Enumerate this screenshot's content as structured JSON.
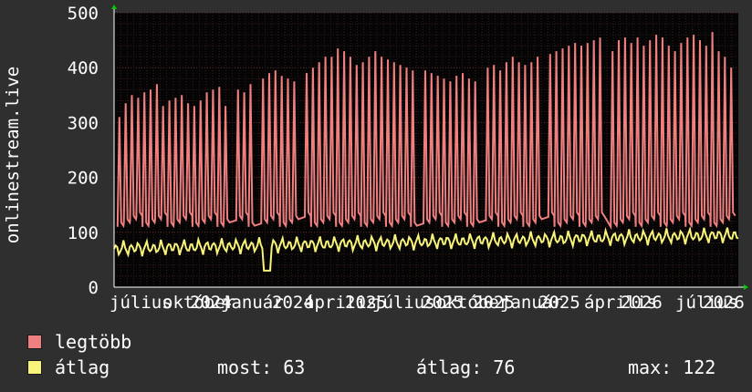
{
  "chart_data": {
    "type": "line",
    "ylabel": "onlinestream.live",
    "ylim": [
      0,
      500
    ],
    "yticks": [
      0,
      100,
      200,
      300,
      400,
      500
    ],
    "grid": true,
    "xticks": [
      "július",
      "október",
      "2024",
      "január",
      "2024",
      "április",
      "2025",
      "július",
      "2025",
      "október",
      "2025",
      "január",
      "2025",
      "április",
      "2026",
      "július",
      "2026"
    ],
    "series": [
      {
        "name": "legtöbb",
        "color": "#f07f7f",
        "peaks": [
          [
            0.01,
            310
          ],
          [
            0.02,
            335
          ],
          [
            0.03,
            350
          ],
          [
            0.04,
            345
          ],
          [
            0.05,
            355
          ],
          [
            0.06,
            360
          ],
          [
            0.07,
            370
          ],
          [
            0.08,
            330
          ],
          [
            0.09,
            340
          ],
          [
            0.1,
            345
          ],
          [
            0.11,
            350
          ],
          [
            0.12,
            335
          ],
          [
            0.13,
            330
          ],
          [
            0.14,
            340
          ],
          [
            0.15,
            355
          ],
          [
            0.16,
            360
          ],
          [
            0.17,
            365
          ],
          [
            0.18,
            330
          ],
          [
            0.2,
            360
          ],
          [
            0.21,
            355
          ],
          [
            0.22,
            370
          ],
          [
            0.24,
            380
          ],
          [
            0.25,
            390
          ],
          [
            0.26,
            395
          ],
          [
            0.27,
            385
          ],
          [
            0.28,
            380
          ],
          [
            0.29,
            375
          ],
          [
            0.31,
            390
          ],
          [
            0.32,
            400
          ],
          [
            0.33,
            410
          ],
          [
            0.34,
            420
          ],
          [
            0.35,
            420
          ],
          [
            0.36,
            435
          ],
          [
            0.37,
            430
          ],
          [
            0.38,
            420
          ],
          [
            0.39,
            405
          ],
          [
            0.4,
            410
          ],
          [
            0.41,
            420
          ],
          [
            0.42,
            430
          ],
          [
            0.43,
            420
          ],
          [
            0.44,
            415
          ],
          [
            0.45,
            410
          ],
          [
            0.46,
            405
          ],
          [
            0.47,
            400
          ],
          [
            0.48,
            395
          ],
          [
            0.5,
            395
          ],
          [
            0.51,
            390
          ],
          [
            0.52,
            385
          ],
          [
            0.53,
            380
          ],
          [
            0.54,
            375
          ],
          [
            0.55,
            385
          ],
          [
            0.56,
            390
          ],
          [
            0.57,
            380
          ],
          [
            0.58,
            375
          ],
          [
            0.6,
            400
          ],
          [
            0.61,
            405
          ],
          [
            0.62,
            395
          ],
          [
            0.63,
            410
          ],
          [
            0.64,
            420
          ],
          [
            0.65,
            410
          ],
          [
            0.66,
            405
          ],
          [
            0.67,
            410
          ],
          [
            0.68,
            420
          ],
          [
            0.7,
            425
          ],
          [
            0.71,
            430
          ],
          [
            0.72,
            435
          ],
          [
            0.73,
            440
          ],
          [
            0.74,
            445
          ],
          [
            0.75,
            440
          ],
          [
            0.76,
            445
          ],
          [
            0.77,
            450
          ],
          [
            0.78,
            455
          ],
          [
            0.8,
            430
          ],
          [
            0.81,
            450
          ],
          [
            0.82,
            455
          ],
          [
            0.83,
            445
          ],
          [
            0.84,
            455
          ],
          [
            0.85,
            440
          ],
          [
            0.86,
            450
          ],
          [
            0.87,
            460
          ],
          [
            0.88,
            455
          ],
          [
            0.89,
            440
          ],
          [
            0.9,
            430
          ],
          [
            0.91,
            445
          ],
          [
            0.92,
            455
          ],
          [
            0.93,
            460
          ],
          [
            0.94,
            450
          ],
          [
            0.95,
            440
          ],
          [
            0.96,
            465
          ],
          [
            0.97,
            430
          ],
          [
            0.98,
            420
          ],
          [
            0.99,
            400
          ]
        ]
      },
      {
        "name": "átlag",
        "color": "#f8f47a",
        "avg": 76
      }
    ]
  },
  "legend": {
    "max_label": "legtöbb",
    "avg_label": "átlag"
  },
  "stats": {
    "now": "most: 63",
    "avg": "átlag: 76",
    "max": "max: 122"
  }
}
